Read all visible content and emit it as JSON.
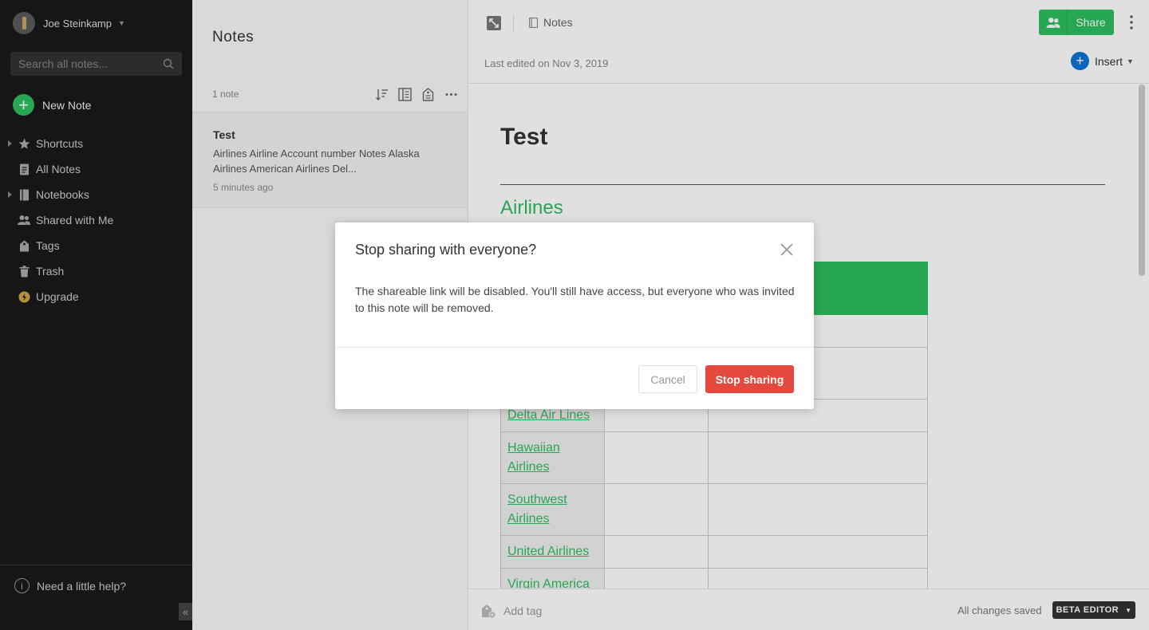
{
  "sidebar": {
    "user_name": "Joe Steinkamp",
    "search_placeholder": "Search all notes...",
    "new_note_label": "New Note",
    "items": [
      {
        "label": "Shortcuts",
        "icon": "star-icon",
        "expandable": true
      },
      {
        "label": "All Notes",
        "icon": "note-icon",
        "expandable": false
      },
      {
        "label": "Notebooks",
        "icon": "notebook-icon",
        "expandable": true
      },
      {
        "label": "Shared with Me",
        "icon": "people-icon",
        "expandable": false
      },
      {
        "label": "Tags",
        "icon": "tag-icon",
        "expandable": false
      },
      {
        "label": "Trash",
        "icon": "trash-icon",
        "expandable": false
      },
      {
        "label": "Upgrade",
        "icon": "upgrade-icon",
        "expandable": false
      }
    ],
    "help_label": "Need a little help?",
    "collapse_glyph": "«"
  },
  "notelist": {
    "title": "Notes",
    "count": "1 note",
    "notes": [
      {
        "title": "Test",
        "snippet": "Airlines Airline Account number Notes Alaska Airlines American Airlines Del...",
        "time": "5 minutes ago"
      }
    ]
  },
  "editor": {
    "notebook_label": "Notes",
    "share_label": "Share",
    "last_edited": "Last edited on Nov 3, 2019",
    "insert_label": "Insert",
    "doc_title": "Test",
    "doc_heading": "Airlines",
    "airlines_visible": [
      "Delta Air Lines",
      "Hawaiian Airlines",
      "Southwest Airlines",
      "United Airlines",
      "Virgin America"
    ],
    "add_tag_label": "Add tag",
    "saved_status": "All changes saved",
    "beta_label": "BETA EDITOR"
  },
  "modal": {
    "title": "Stop sharing with everyone?",
    "body": "The shareable link will be disabled. You'll still have access, but everyone who was invited to this note will be removed.",
    "cancel_label": "Cancel",
    "confirm_label": "Stop sharing"
  },
  "colors": {
    "brand_green": "#2dbe60",
    "danger_red": "#e3493c",
    "insert_blue": "#0d74d6",
    "sidebar_bg": "#1a1a1a"
  }
}
